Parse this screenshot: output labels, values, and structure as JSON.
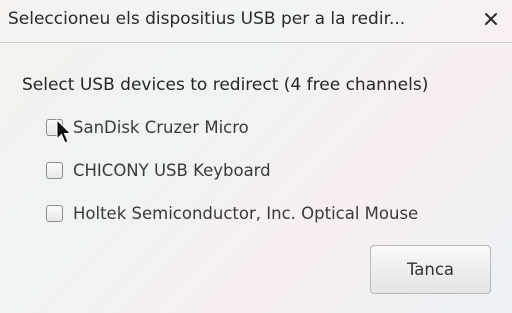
{
  "window": {
    "title": "Seleccioneu els dispositius USB per a la redir...",
    "close_icon": "close-icon"
  },
  "content": {
    "heading": "Select USB devices to redirect (4 free channels)",
    "devices": [
      {
        "label": "SanDisk Cruzer Micro",
        "checked": false
      },
      {
        "label": "CHICONY USB Keyboard",
        "checked": false
      },
      {
        "label": "Holtek Semiconductor, Inc. Optical Mouse",
        "checked": false
      }
    ]
  },
  "actions": {
    "close_label": "Tanca"
  }
}
